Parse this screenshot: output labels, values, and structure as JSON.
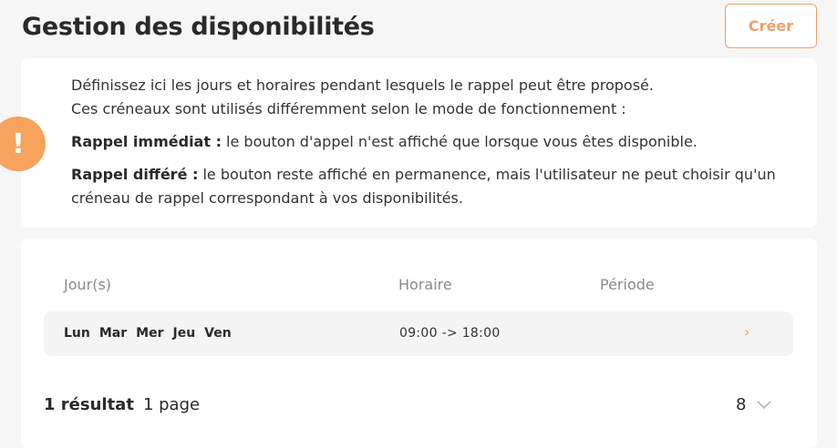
{
  "header": {
    "title": "Gestion des disponibilités",
    "create_label": "Créer"
  },
  "info": {
    "icon_glyph": "!",
    "line1": "Définissez ici les jours et horaires pendant lesquels le rappel peut être proposé.",
    "line2": "Ces créneaux sont utilisés différemment selon le mode de fonctionnement :",
    "immediate_label": "Rappel immédiat :",
    "immediate_text": " le bouton d'appel n'est affiché que lorsque vous êtes disponible.",
    "deferred_label": "Rappel différé :",
    "deferred_text": " le bouton reste affiché en permanence, mais l'utilisateur ne peut choisir qu'un créneau de rappel correspondant à vos disponibilités."
  },
  "table": {
    "columns": [
      "Jour(s)",
      "Horaire",
      "Période"
    ],
    "rows": [
      {
        "days": [
          "Lun",
          "Mar",
          "Mer",
          "Jeu",
          "Ven"
        ],
        "hours": "09:00 -> 18:00",
        "period": "",
        "chevron": "›"
      }
    ]
  },
  "pagination": {
    "results": "1 résultat",
    "pages": "1 page",
    "page_size": "8"
  },
  "colors": {
    "accent": "#f0a06a",
    "info_icon": "#f7a35e",
    "background": "#f6f6f6",
    "card": "#ffffff",
    "row": "#f4f4f4"
  },
  "icons": {
    "info": "exclamation-icon",
    "row_chevron": "chevron-right-icon",
    "page_size": "chevron-down-icon"
  }
}
